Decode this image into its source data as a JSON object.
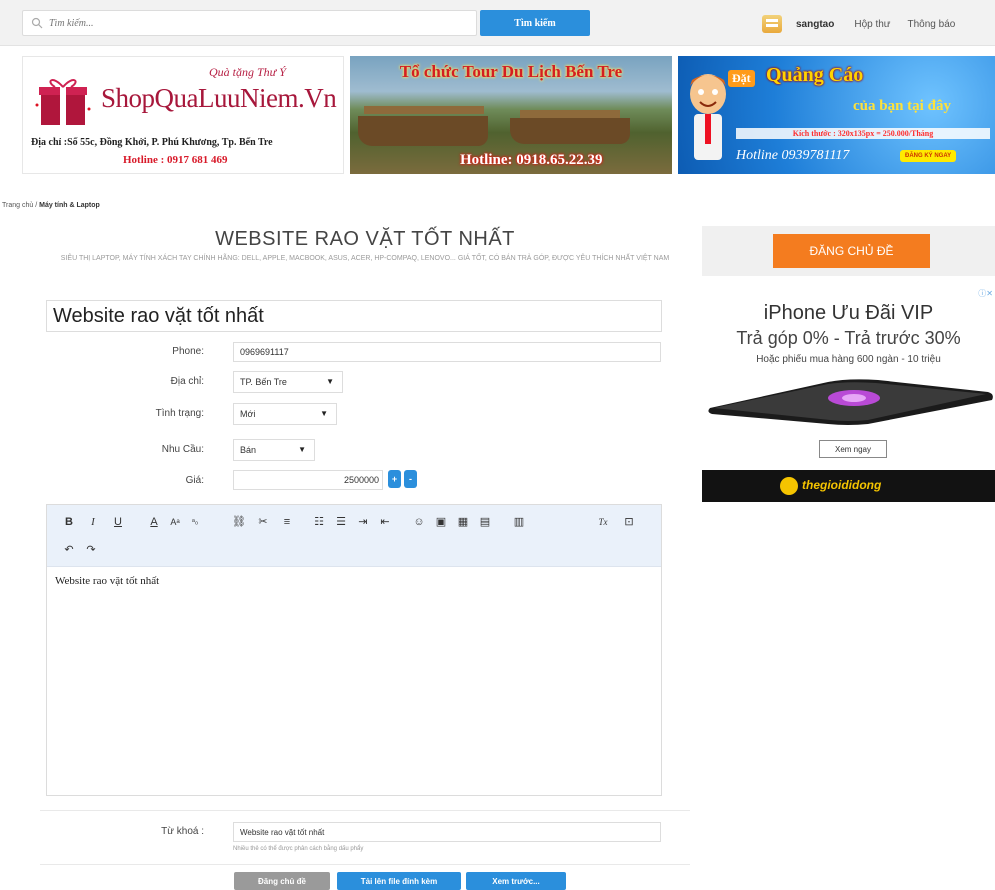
{
  "topbar": {
    "search_placeholder": "Tìm kiếm...",
    "search_button": "Tìm kiếm",
    "username": "sangtao",
    "inbox": "Hộp thư",
    "notifications": "Thông báo"
  },
  "banners": {
    "shop": {
      "promo": "Quà tặng Thư Ý",
      "title": "ShopQuaLuuNiem.Vn",
      "address": "Địa chỉ :Số 55c, Đồng Khởi, P. Phú Khương, Tp. Bến Tre",
      "hotline": "Hotline : 0917 681 469"
    },
    "tour": {
      "title": "Tổ chức Tour Du Lịch Bến Tre",
      "hotline": "Hotline: 0918.65.22.39"
    },
    "ads": {
      "dat": "Đặt",
      "quang_cao": "Quảng Cáo",
      "cua_ban": "của bạn tại đây",
      "size": "Kích thước : 320x135px = 250.000/Tháng",
      "hotline": "Hotline 0939781117",
      "register": "ĐĂNG KÝ NGAY"
    }
  },
  "breadcrumb": {
    "home": "Trang chủ",
    "separator": "/",
    "current": "Máy tính & Laptop"
  },
  "heading": {
    "title": "WEBSITE RAO VẶT TỐT NHẤT",
    "subtitle": "SIÊU THỊ LAPTOP, MÁY TÍNH XÁCH TAY CHÍNH HÃNG: DELL, APPLE, MACBOOK, ASUS, ACER, HP-COMPAQ, LENOVO... GIÁ TỐT, CÓ BÁN TRẢ GÓP, ĐƯỢC YÊU THÍCH NHẤT VIỆT NAM"
  },
  "sidebar": {
    "post_button": "ĐĂNG CHỦ ĐỀ",
    "ad": {
      "title": "iPhone Ưu Đãi VIP",
      "line2": "Trả góp 0% - Trả trước 30%",
      "line3": "Hoặc phiếu mua hàng 600 ngàn - 10 triệu",
      "button": "Xem ngay",
      "brand": "thegioididong"
    }
  },
  "form": {
    "title_value": "Website rao vặt tốt nhất",
    "phone_label": "Phone:",
    "phone_value": "0969691117",
    "address_label": "Địa chỉ:",
    "address_value": "TP. Bến Tre",
    "condition_label": "Tình trạng:",
    "condition_value": "Mới",
    "need_label": "Nhu Cầu:",
    "need_value": "Bán",
    "price_label": "Giá:",
    "price_value": "2500000",
    "plus": "+",
    "minus": "-",
    "editor_content": "Website rao vặt tốt nhất",
    "keywords_label": "Từ khoá :",
    "keywords_value": "Website rao vặt tốt nhất",
    "keywords_help": "Nhiều thẻ có thể được phân cách bằng dấu phẩy"
  },
  "toolbar": {
    "bold": "B",
    "italic": "I",
    "underline": "U",
    "text_color": "A",
    "font_size": "Aᵃ",
    "subscript": "ᵃ₀",
    "remove_format": "Tx"
  },
  "actions": {
    "post": "Đăng chủ đề",
    "upload": "Tải lên file đính kèm",
    "preview": "Xem trước..."
  }
}
